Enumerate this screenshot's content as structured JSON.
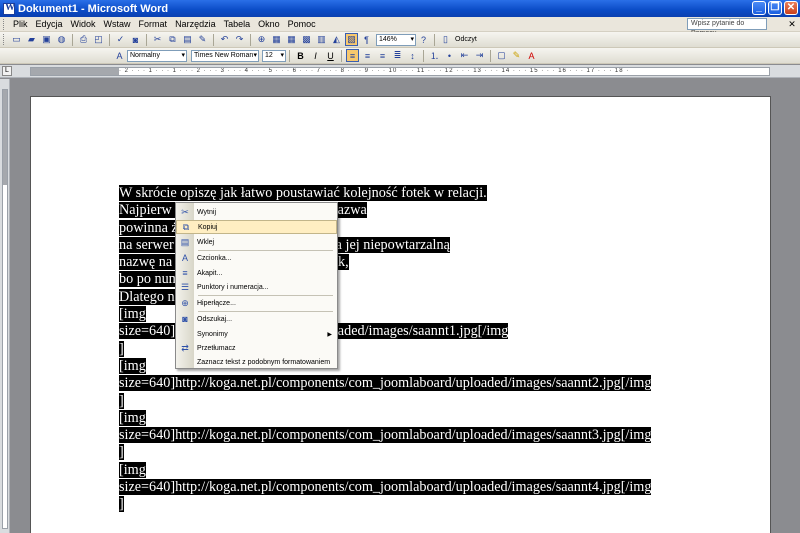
{
  "window": {
    "title": "Dokument1 - Microsoft Word"
  },
  "menu": {
    "items": [
      "Plik",
      "Edycja",
      "Widok",
      "Wstaw",
      "Format",
      "Narzędzia",
      "Tabela",
      "Okno",
      "Pomoc"
    ],
    "ask_placeholder": "Wpisz pytanie do Pomocy"
  },
  "toolbar": {
    "zoom": "146%",
    "read_label": "Odczyt",
    "style": "Normalny",
    "font": "Times New Roman",
    "size": "12"
  },
  "ruler": {
    "ticks": "· 2 · · · 1 · · · 1 · · · 2 · · · 3 · · · 4 · · · 5 · · · 6 · · · 7 · · · 8 · · · 9 · · · 10 · · · 11 · · · 12 · · · 13 · · · 14 · · · 15 · · · 16 · · · 17 · · · 18 ·"
  },
  "document": {
    "lines": [
      "W skrócie opiszę jak łatwo poustawiać kolejność fotek w relacji.",
      "Najpierw                                       ki. Kolejność dowolna, ale nazwa",
      "powinna                                        ż w przypadku gdy jest już",
      "na serwer                                      program automatycznie nada jej niepowtarzalną",
      "nazwę na                                       nia to potem sortowanie fotek,",
      "bo po num                                      co jest treścią fotki.",
      "Dlatego n                                      jak poniżej:",
      " ",
      "[img",
      "size=640]                                  ents/com_joomlaboard/uploaded/images/saannt1.jpg[/img",
      "]",
      "[img",
      "size=640]http://koga.net.pl/components/com_joomlaboard/uploaded/images/saannt2.jpg[/img",
      "]",
      "[img",
      "size=640]http://koga.net.pl/components/com_joomlaboard/uploaded/images/saannt3.jpg[/img",
      "]",
      "[img",
      "size=640]http://koga.net.pl/components/com_joomlaboard/uploaded/images/saannt4.jpg[/img",
      "]"
    ]
  },
  "context_menu": {
    "items": [
      {
        "label": "Wytnij",
        "icon": "scissors-icon"
      },
      {
        "label": "Kopiuj",
        "icon": "copy-icon"
      },
      {
        "label": "Wklej",
        "icon": "paste-icon"
      },
      {
        "label": "Czcionka...",
        "icon": "font-icon"
      },
      {
        "label": "Akapit...",
        "icon": "paragraph-icon"
      },
      {
        "label": "Punktory i numeracja...",
        "icon": "bullets-icon"
      },
      {
        "label": "Hiperłącze...",
        "icon": "hyperlink-icon"
      },
      {
        "label": "Odszukaj...",
        "icon": "research-icon"
      },
      {
        "label": "Synonimy",
        "icon": ""
      },
      {
        "label": "Przetłumacz",
        "icon": "translate-icon"
      },
      {
        "label": "Zaznacz tekst z podobnym formatowaniem",
        "icon": ""
      }
    ]
  },
  "colors": {
    "titlebar": "#0a4bc6",
    "selection": "#000000",
    "menu_highlight": "#ffeec2"
  }
}
